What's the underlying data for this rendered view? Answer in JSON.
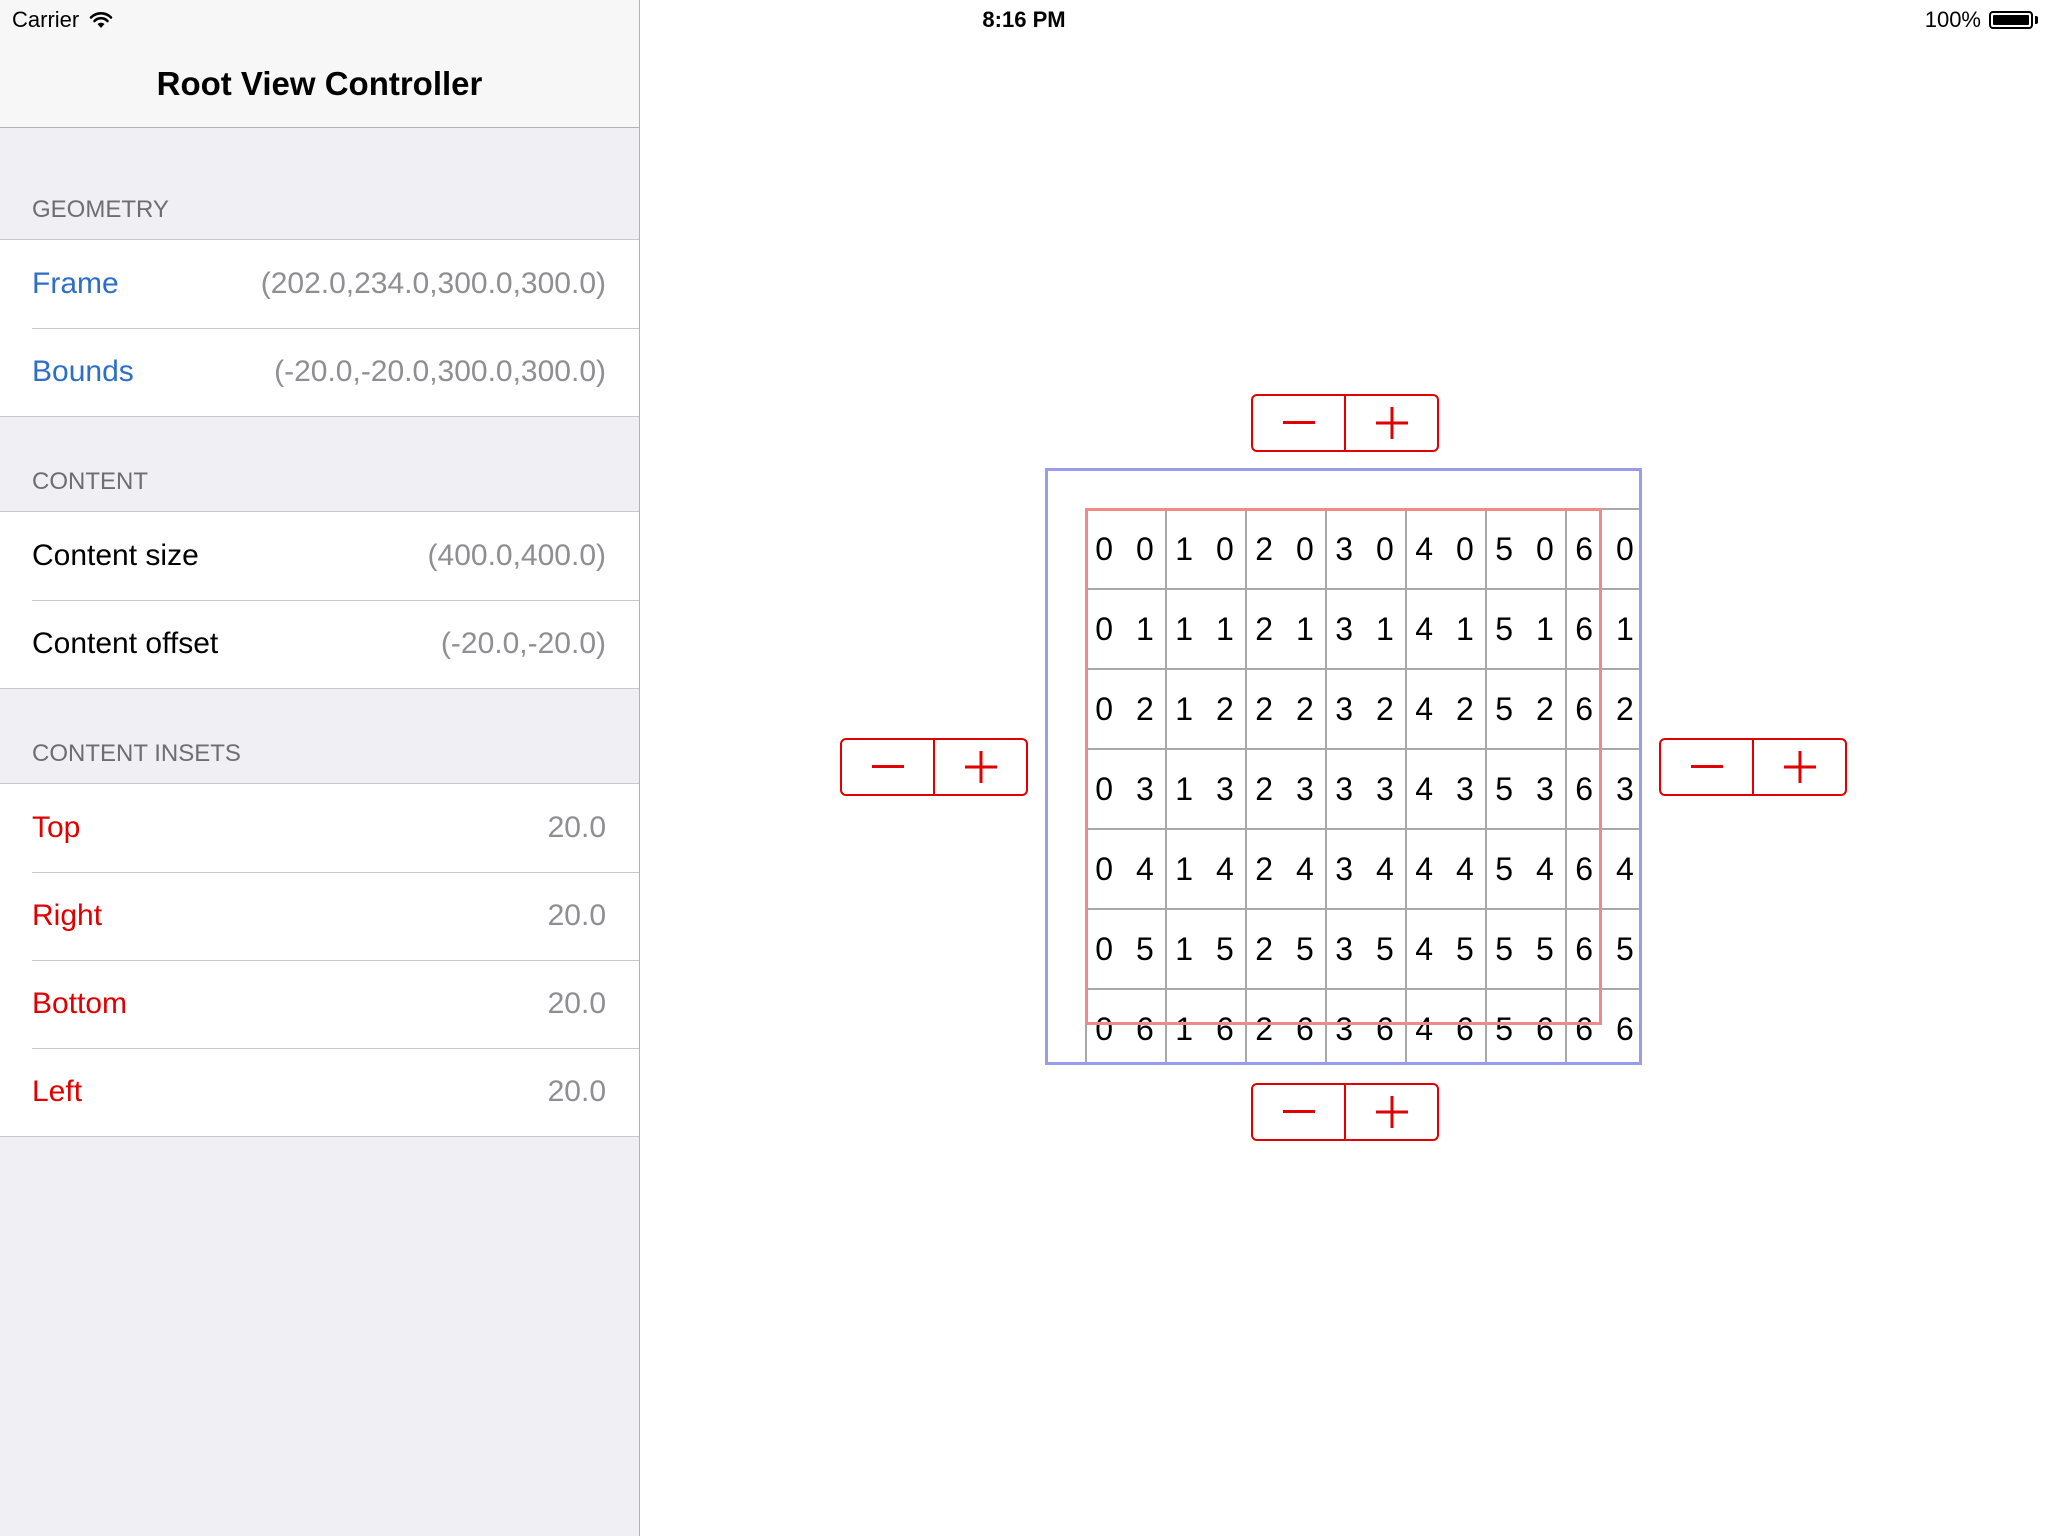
{
  "status_bar": {
    "carrier": "Carrier",
    "time": "8:16 PM",
    "battery": "100%",
    "battery_level": 1.0
  },
  "navbar": {
    "title": "Root View Controller"
  },
  "sections": {
    "geometry": {
      "header": "GEOMETRY",
      "rows": [
        {
          "label": "Frame",
          "value": "(202.0,234.0,300.0,300.0)"
        },
        {
          "label": "Bounds",
          "value": "(-20.0,-20.0,300.0,300.0)"
        }
      ]
    },
    "content": {
      "header": "CONTENT",
      "rows": [
        {
          "label": "Content size",
          "value": "(400.0,400.0)"
        },
        {
          "label": "Content offset",
          "value": "(-20.0,-20.0)"
        }
      ]
    },
    "insets": {
      "header": "CONTENT INSETS",
      "rows": [
        {
          "label": "Top",
          "value": "20.0"
        },
        {
          "label": "Right",
          "value": "20.0"
        },
        {
          "label": "Bottom",
          "value": "20.0"
        },
        {
          "label": "Left",
          "value": "20.0"
        }
      ]
    }
  },
  "grid": {
    "rows": [
      [
        "0 0",
        "1 0",
        "2 0",
        "3 0",
        "4 0",
        "5 0",
        "6 0"
      ],
      [
        "0 1",
        "1 1",
        "2 1",
        "3 1",
        "4 1",
        "5 1",
        "6 1"
      ],
      [
        "0 2",
        "1 2",
        "2 2",
        "3 2",
        "4 2",
        "5 2",
        "6 2"
      ],
      [
        "0 3",
        "1 3",
        "2 3",
        "3 3",
        "4 3",
        "5 3",
        "6 3"
      ],
      [
        "0 4",
        "1 4",
        "2 4",
        "3 4",
        "4 4",
        "5 4",
        "6 4"
      ],
      [
        "0 5",
        "1 5",
        "2 5",
        "3 5",
        "4 5",
        "5 5",
        "6 5"
      ],
      [
        "0 6",
        "1 6",
        "2 6",
        "3 6",
        "4 6",
        "5 6",
        "6 6"
      ]
    ]
  },
  "steppers": [
    {
      "id": "top",
      "minus_icon": "minus-icon",
      "plus_icon": "plus-icon"
    },
    {
      "id": "left",
      "minus_icon": "minus-icon",
      "plus_icon": "plus-icon"
    },
    {
      "id": "right",
      "minus_icon": "minus-icon",
      "plus_icon": "plus-icon"
    },
    {
      "id": "bottom",
      "minus_icon": "minus-icon",
      "plus_icon": "plus-icon"
    }
  ],
  "colors": {
    "sidebar_bg": "#efeff4",
    "blue_label": "#2d6ec6",
    "red_label": "#e00000",
    "value_gray": "#8e8e93",
    "frame_border": "#9a9aee",
    "inset_border": "#f08a8a",
    "stepper_red": "#e00000"
  }
}
